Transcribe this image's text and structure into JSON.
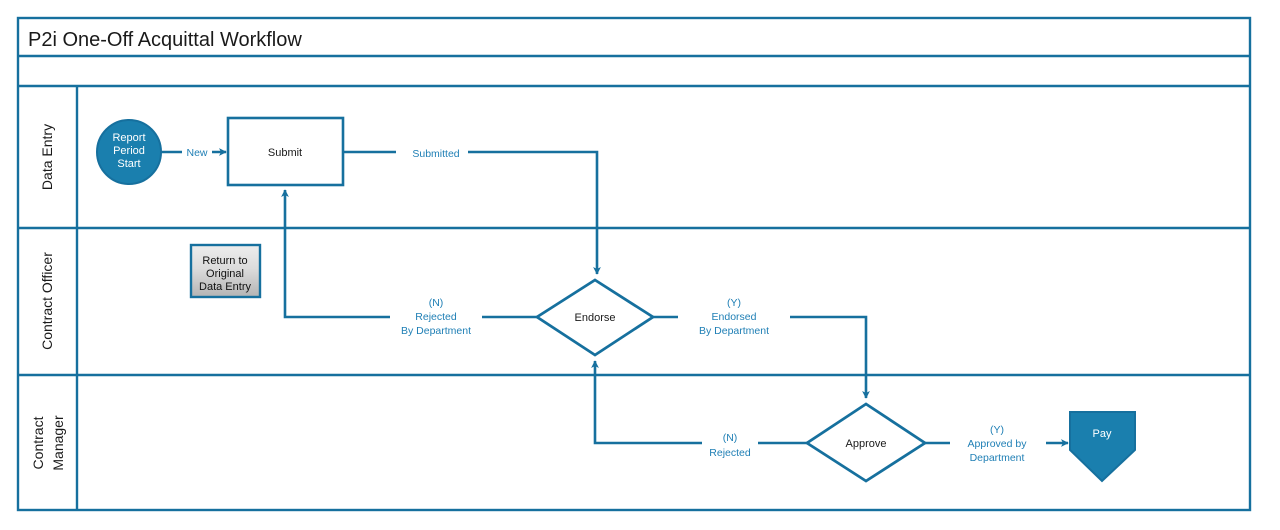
{
  "diagram": {
    "title": "P2i One-Off Acquittal Workflow",
    "colors": {
      "frame": "#16709e",
      "line": "#16709e",
      "fill_blue": "#1a7fae",
      "label_blue": "#1f7fb5",
      "box_gray_top": "#e8e8e8",
      "box_gray_bottom": "#b9b9b9",
      "text_dark": "#1a1a1a",
      "text_light": "#ffffff",
      "background": "#ffffff"
    },
    "lanes": [
      {
        "id": "data-entry",
        "name": "Data Entry"
      },
      {
        "id": "contract-officer",
        "name": "Contract Officer"
      },
      {
        "id": "contract-manager",
        "name": "Contract\nManager"
      }
    ],
    "nodes": [
      {
        "id": "report-period-start",
        "type": "start-circle",
        "lane": "data-entry",
        "label": "Report Period Start",
        "label_lines": [
          "Report",
          "Period",
          "Start"
        ]
      },
      {
        "id": "submit",
        "type": "process-box",
        "lane": "data-entry",
        "label": "Submit",
        "label_lines": [
          "Submit"
        ]
      },
      {
        "id": "return-to-original-data-entry",
        "type": "note-box",
        "lane": "contract-officer",
        "label": "Return to Original Data Entry",
        "label_lines": [
          "Return to",
          "Original",
          "Data Entry"
        ]
      },
      {
        "id": "endorse",
        "type": "decision-diamond",
        "lane": "contract-officer",
        "label": "Endorse",
        "label_lines": [
          "Endorse"
        ]
      },
      {
        "id": "approve",
        "type": "decision-diamond",
        "lane": "contract-manager",
        "label": "Approve",
        "label_lines": [
          "Approve"
        ]
      },
      {
        "id": "pay",
        "type": "terminator-pentagon",
        "lane": "contract-manager",
        "label": "Pay",
        "label_lines": [
          "Pay"
        ]
      }
    ],
    "edges": [
      {
        "id": "start-to-submit",
        "from": "report-period-start",
        "to": "submit",
        "label": "New",
        "label_lines": [
          "New"
        ]
      },
      {
        "id": "submit-to-endorse",
        "from": "submit",
        "to": "endorse",
        "label": "Submitted",
        "label_lines": [
          "Submitted"
        ]
      },
      {
        "id": "endorse-rejected-to-submit",
        "from": "endorse",
        "to": "submit",
        "label": "(N) Rejected By Department",
        "label_lines": [
          "(N)",
          "Rejected",
          "By Department"
        ]
      },
      {
        "id": "endorse-endorsed-to-approve",
        "from": "endorse",
        "to": "approve",
        "label": "(Y) Endorsed By Department",
        "label_lines": [
          "(Y)",
          "Endorsed",
          "By Department"
        ]
      },
      {
        "id": "approve-rejected-to-endorse",
        "from": "approve",
        "to": "endorse",
        "label": "(N) Rejected",
        "label_lines": [
          "(N)",
          "Rejected"
        ]
      },
      {
        "id": "approve-approved-to-pay",
        "from": "approve",
        "to": "pay",
        "label": "(Y) Approved by Department",
        "label_lines": [
          "(Y)",
          "Approved by",
          "Department"
        ]
      }
    ]
  }
}
